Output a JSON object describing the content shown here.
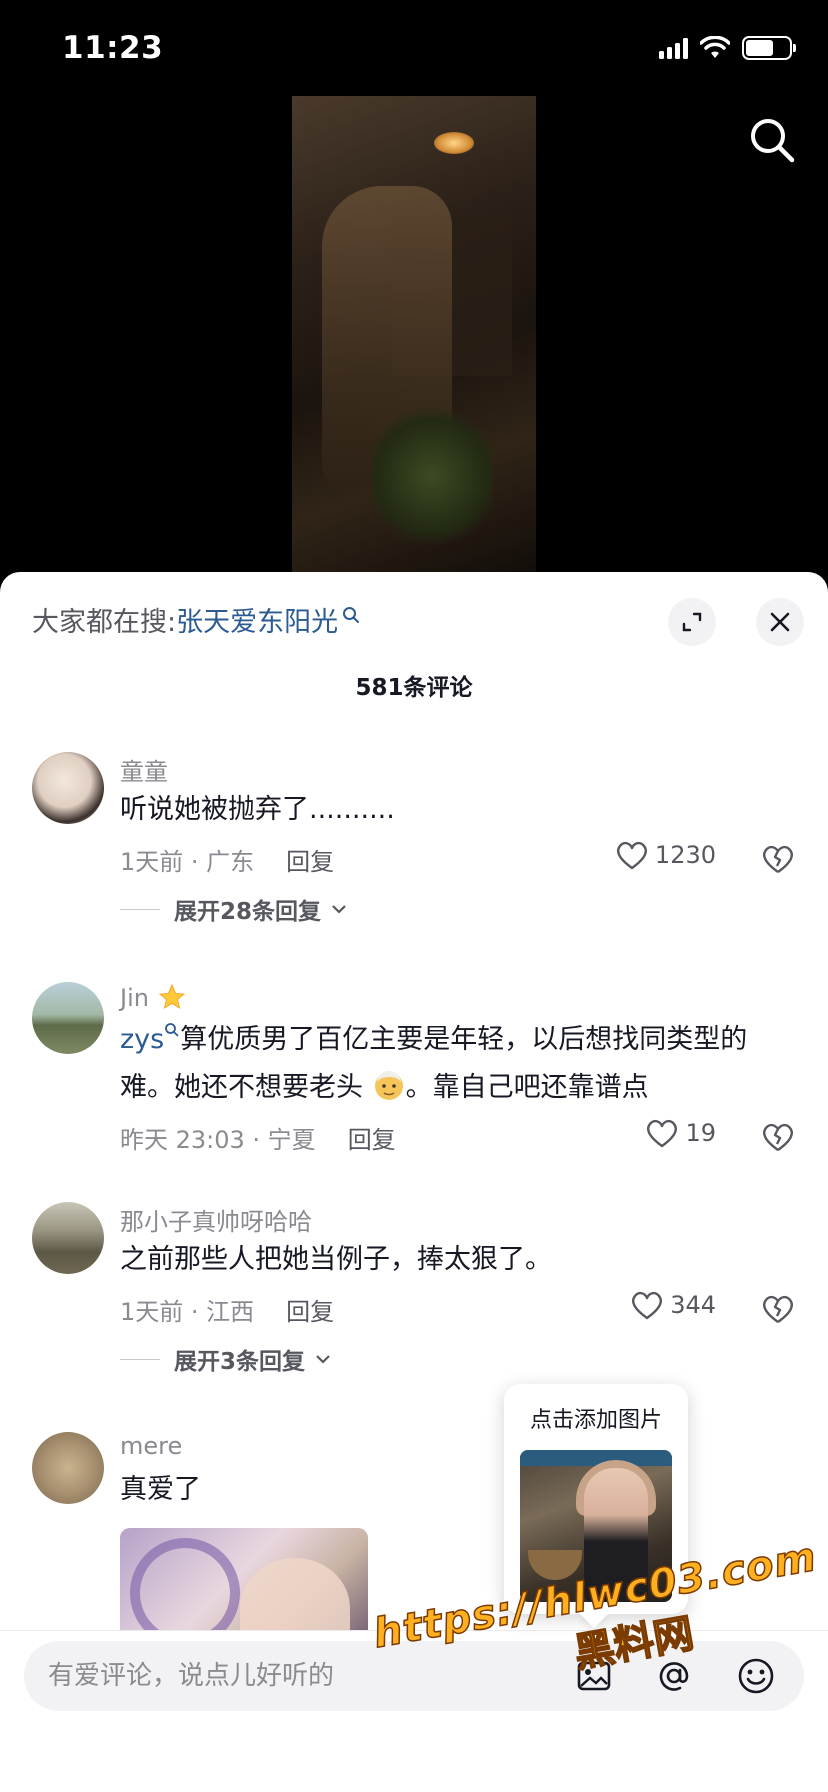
{
  "status_bar": {
    "time": "11:23"
  },
  "header": {
    "hot_search_label": "大家都在搜:",
    "hot_search_keyword": "张天爱东阳光",
    "comment_count_label": "581条评论"
  },
  "comments": [
    {
      "user": "童童",
      "text": "听说她被抛弃了..........",
      "time_location": "1天前 · 广东",
      "reply_label": "回复",
      "likes": "1230",
      "expand_label": "展开28条回复"
    },
    {
      "user": "Jin",
      "mention": "zys",
      "text_part1": "算优质男了百亿主要是年轻，以后想找同类型的难。她还不想要老头",
      "text_part2": "。靠自己吧还靠谱点",
      "time_location": "昨天 23:03 · 宁夏",
      "reply_label": "回复",
      "likes": "19"
    },
    {
      "user": "那小子真帅呀哈哈",
      "text": "之前那些人把她当例子，捧太狠了。",
      "time_location": "1天前 · 江西",
      "reply_label": "回复",
      "likes": "344",
      "expand_label": "展开3条回复"
    },
    {
      "user": "mere",
      "text": "真爱了"
    }
  ],
  "popover": {
    "title": "点击添加图片"
  },
  "input": {
    "placeholder": "有爱评论，说点儿好听的"
  },
  "watermark": {
    "url": "https://hlwc03.com",
    "site": "黑料网"
  },
  "colors": {
    "accent_link": "#2c5b93",
    "text_primary": "#161823",
    "text_secondary": "#8a8b91"
  }
}
